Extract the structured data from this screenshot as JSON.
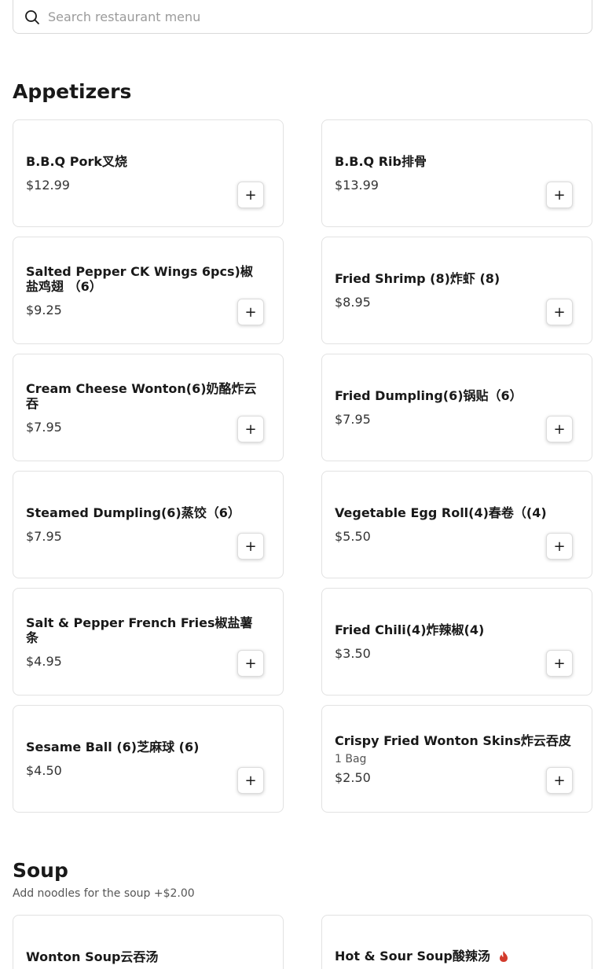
{
  "search": {
    "placeholder": "Search restaurant menu"
  },
  "sections": [
    {
      "title": "Appetizers",
      "items": [
        {
          "name": "B.B.Q Pork叉烧",
          "price": "$12.99"
        },
        {
          "name": "B.B.Q Rib排骨",
          "price": "$13.99"
        },
        {
          "name": "Salted Pepper CK Wings 6pcs)椒盐鸡翅 （6）",
          "price": "$9.25"
        },
        {
          "name": "Fried Shrimp (8)炸虾 (8)",
          "price": "$8.95"
        },
        {
          "name": "Cream Cheese Wonton(6)奶酪炸云吞",
          "price": "$7.95"
        },
        {
          "name": "Fried Dumpling(6)锅贴（6）",
          "price": "$7.95"
        },
        {
          "name": "Steamed Dumpling(6)蒸饺（6）",
          "price": "$7.95"
        },
        {
          "name": "Vegetable Egg Roll(4)春卷（(4)",
          "price": "$5.50"
        },
        {
          "name": "Salt & Pepper French Fries椒盐薯条",
          "price": "$4.95"
        },
        {
          "name": "Fried Chili(4)炸辣椒(4)",
          "price": "$3.50"
        },
        {
          "name": "Sesame Ball (6)芝麻球 (6)",
          "price": "$4.50"
        },
        {
          "name": "Crispy Fried Wonton Skins炸云吞皮",
          "desc": "1 Bag",
          "price": "$2.50"
        }
      ]
    },
    {
      "title": "Soup",
      "subtitle": "Add noodles for the soup +$2.00",
      "items": [
        {
          "name": "Wonton Soup云吞汤"
        },
        {
          "name": "Hot & Sour Soup酸辣汤",
          "spicy_icon": "flame-icon"
        }
      ]
    }
  ],
  "add_button_label": "+",
  "colors": {
    "spicy": "#d23b2c",
    "border": "#e2e2e2"
  }
}
